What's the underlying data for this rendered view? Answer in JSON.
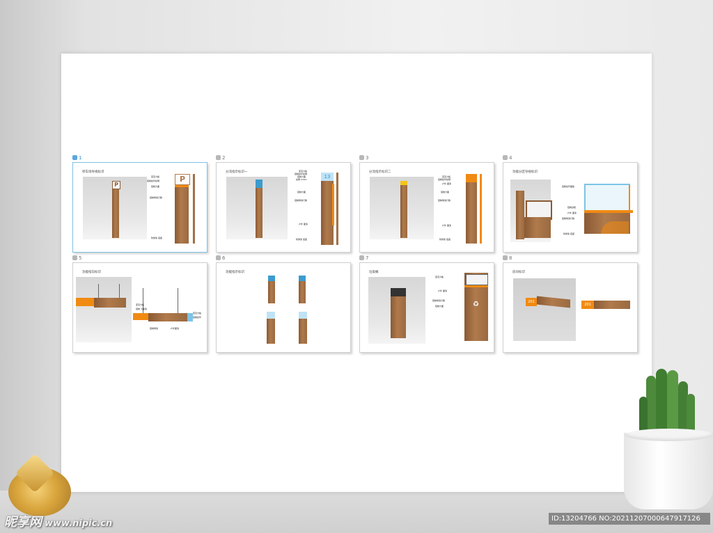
{
  "slides": [
    {
      "num": "1",
      "title": "停车场导视标识",
      "active": true,
      "callouts": [
        "亚克力板",
        "铝制丝印丝网",
        "铝制力面",
        "铝制烤漆灯箱",
        "防锈漆 底座"
      ]
    },
    {
      "num": "2",
      "title": "分流指示标识一",
      "active": false,
      "callouts": [
        "亚克力板",
        "铝制丝印丝网",
        "铝制力面",
        "丝网 LOGO",
        "铝制力面",
        "铝制烤漆灯箱",
        "户外 面漆",
        "防锈漆 底座"
      ]
    },
    {
      "num": "3",
      "title": "分流指示标识二",
      "active": false,
      "callouts": [
        "亚克力板",
        "铝制丝印丝网",
        "户外 面漆",
        "铝制力面",
        "铝制烤漆灯箱",
        "户外 面漆",
        "防锈漆 底座"
      ]
    },
    {
      "num": "4",
      "title": "功能分区导视标识",
      "active": false,
      "callouts": [
        "铝制丝印面板",
        "铝制边框",
        "户外 面漆",
        "铝制烤漆灯箱",
        "防锈漆 底座"
      ]
    },
    {
      "num": "5",
      "title": "功能指向标识",
      "active": false,
      "callouts": [
        "亚克力板",
        "铝制 力面漆",
        "亚克力板",
        "铝制丝印",
        "铝制烤漆",
        "户外面漆"
      ]
    },
    {
      "num": "6",
      "title": "功能指示标识",
      "active": false,
      "callouts": []
    },
    {
      "num": "7",
      "title": "垃圾桶",
      "active": false,
      "callouts": [
        "亚克力板",
        "户外 面漆",
        "铝制烤漆灯箱",
        "铝制力面"
      ]
    },
    {
      "num": "8",
      "title": "房间标识",
      "active": false,
      "callouts": [
        "201",
        "201"
      ]
    }
  ],
  "watermark": {
    "brand": "昵享网",
    "url": "www.nipic.cn",
    "id_text": "ID:13204766 NO:20211207000647917126"
  },
  "colors": {
    "accent_orange": "#f08a12",
    "wood": "#a8744a",
    "active_border": "#7fc0e6"
  }
}
